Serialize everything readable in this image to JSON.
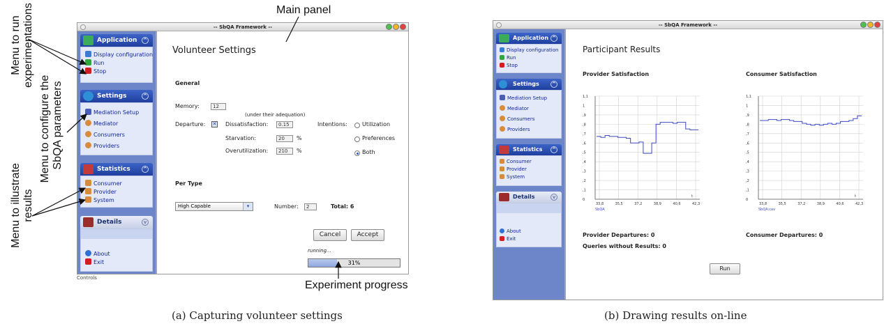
{
  "left_window": {
    "title": "-- SbQA Framework --",
    "sidebar": {
      "application": {
        "title": "Application",
        "items": [
          "Display configuration",
          "Run",
          "Stop"
        ]
      },
      "settings": {
        "title": "Settings",
        "items": [
          "Mediation Setup",
          "Mediator",
          "Consumers",
          "Providers"
        ]
      },
      "statistics": {
        "title": "Statistics",
        "items": [
          "Consumer",
          "Provider",
          "System"
        ]
      },
      "details": {
        "title": "Details",
        "items": [
          "About",
          "Exit"
        ]
      }
    },
    "panel": {
      "heading": "Volunteer Settings",
      "general": "General",
      "memory_label": "Memory:",
      "memory_value": "12",
      "under_note": "(under their adequation)",
      "departure_label": "Departure:",
      "dissatisfaction_label": "Dissatisfaction:",
      "dissatisfaction_value": "0.15",
      "starvation_label": "Starvation:",
      "starvation_value": "20",
      "overutilization_label": "Overutilization:",
      "overutilization_value": "210",
      "percent": "%",
      "intentions_label": "Intentions:",
      "intention_options": [
        "Utilization",
        "Preferences",
        "Both"
      ],
      "per_type": "Per Type",
      "type_selected": "High Capable",
      "number_label": "Number:",
      "number_value": "2",
      "total_label": "Total: 6",
      "cancel": "Cancel",
      "accept": "Accept",
      "running": "running...",
      "progress": 0.31,
      "progress_text": "31%"
    },
    "bottom_text": "Controls"
  },
  "right_window": {
    "title": "-- SbQA Framework --",
    "sidebar": {
      "application": {
        "title": "Application",
        "items": [
          "Display configuration",
          "Run",
          "Stop"
        ]
      },
      "settings": {
        "title": "Settings",
        "items": [
          "Mediation Setup",
          "Mediator",
          "Consumers",
          "Providers"
        ]
      },
      "statistics": {
        "title": "Statistics",
        "items": [
          "Consumer",
          "Provider",
          "System"
        ]
      },
      "details": {
        "title": "Details",
        "items": [
          "About",
          "Exit"
        ]
      }
    },
    "panel": {
      "heading": "Participant Results",
      "provider_title": "Provider Satisfaction",
      "consumer_title": "Consumer Satisfaction",
      "provider_departures": "Provider Departures: 0",
      "consumer_departures": "Consumer Departures: 0",
      "queries": "Queries without Results: 0",
      "run": "Run"
    }
  },
  "annotations": {
    "main_panel": "Main panel",
    "menu_run": [
      "Menu to run",
      "experimentations"
    ],
    "menu_config": [
      "Menu to configure the",
      "SbQA parameters"
    ],
    "menu_results": [
      "Menu to illustrate",
      "results"
    ],
    "progress": "Experiment progress"
  },
  "captions": {
    "left": "(a) Capturing volunteer settings",
    "right": "(b) Drawing results on-line"
  },
  "chart_data": [
    {
      "type": "line",
      "x_ticks": [
        "33,8",
        "35,5",
        "37,2",
        "38,9",
        "40,6",
        "42,3"
      ],
      "y_ticks": [
        "0",
        ",1",
        ",2",
        ",3",
        ",4",
        ",5",
        ",6",
        ",7",
        ",8",
        ",9",
        "1",
        "1,1"
      ],
      "ylim": [
        0,
        1.1
      ],
      "x_unit": "t",
      "series_label": "SbQA",
      "series": [
        {
          "name": "",
          "color": "#3d4bc4",
          "values": [
            0.67,
            0.66,
            0.68,
            0.67,
            0.67,
            0.66,
            0.66,
            0.65,
            0.6,
            0.6,
            0.61,
            0.49,
            0.49,
            0.6,
            0.8,
            0.82,
            0.82,
            0.82,
            0.81,
            0.82,
            0.82,
            0.75,
            0.74,
            0.74
          ]
        }
      ]
    },
    {
      "type": "line",
      "x_ticks": [
        "33,8",
        "35,5",
        "37,2",
        "38,9",
        "40,6",
        "42,3"
      ],
      "y_ticks": [
        "0",
        ",1",
        ",2",
        ",3",
        ",4",
        ",5",
        ",6",
        ",7",
        ",8",
        ",9",
        "1",
        "1,1"
      ],
      "ylim": [
        0,
        1.1
      ],
      "x_unit": "t",
      "series_label": "SbQA:cav",
      "series": [
        {
          "name": "",
          "color": "#3d4bc4",
          "values": [
            0.84,
            0.84,
            0.85,
            0.85,
            0.84,
            0.85,
            0.85,
            0.84,
            0.83,
            0.83,
            0.81,
            0.8,
            0.79,
            0.8,
            0.79,
            0.8,
            0.81,
            0.8,
            0.81,
            0.83,
            0.83,
            0.84,
            0.86,
            0.89
          ]
        }
      ]
    }
  ]
}
